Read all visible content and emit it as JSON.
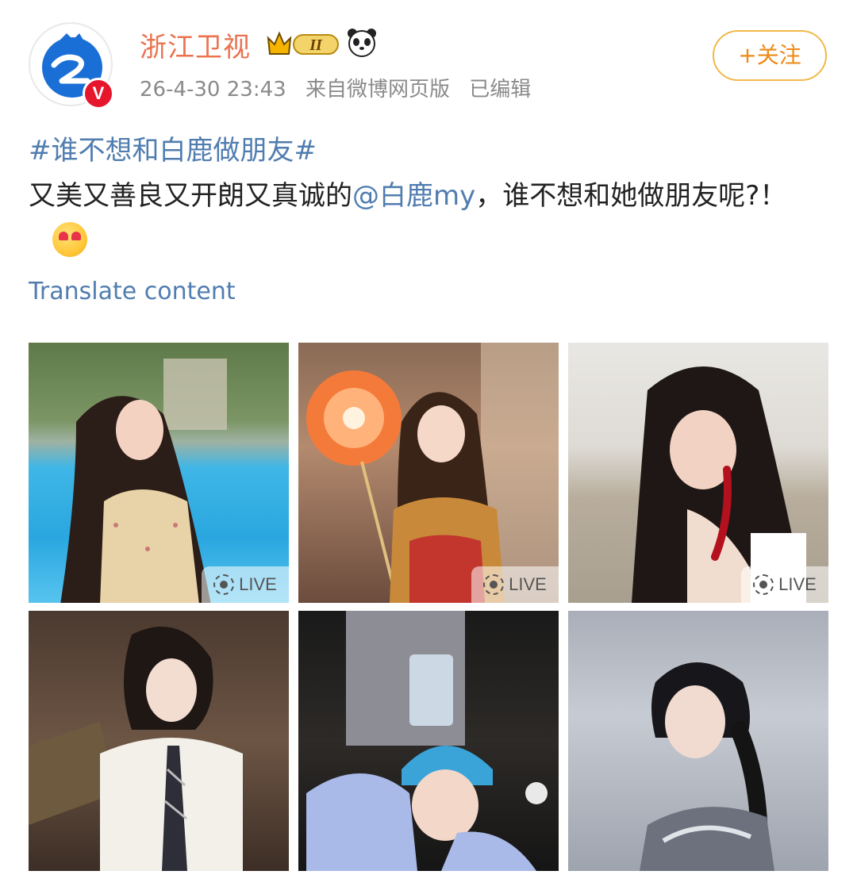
{
  "post": {
    "author": {
      "name": "浙江卫视",
      "vip_level": "II",
      "verified_badge": "V"
    },
    "meta": {
      "date": "26-4-30 23:43",
      "source": "来自微博网页版",
      "edited": "已编辑"
    },
    "follow_label": "+关注",
    "hashtag": "#谁不想和白鹿做朋友#",
    "text_before": "又美又善良又开朗又真诚的",
    "mention": "@白鹿my",
    "text_after": "，谁不想和她做朋友呢?！",
    "translate_label": "Translate content",
    "images": [
      {
        "name": "photo-pool",
        "live": "LIVE"
      },
      {
        "name": "photo-pinwheel",
        "live": "LIVE"
      },
      {
        "name": "photo-red-earring",
        "live": "LIVE"
      },
      {
        "name": "photo-white-shirt-tie",
        "live": ""
      },
      {
        "name": "photo-blue-helmet",
        "live": ""
      },
      {
        "name": "photo-silver-dress",
        "live": ""
      }
    ]
  },
  "colors": {
    "username": "#eb7350",
    "link": "#507daf",
    "follow": "#ee8a17",
    "badge_red": "#e6162d"
  },
  "icons": [
    "zhejiang-tv-logo-icon",
    "verified-v-icon",
    "vip-crown-icon",
    "panda-icon",
    "live-photo-icon",
    "heart-eyes-emoji-icon"
  ]
}
